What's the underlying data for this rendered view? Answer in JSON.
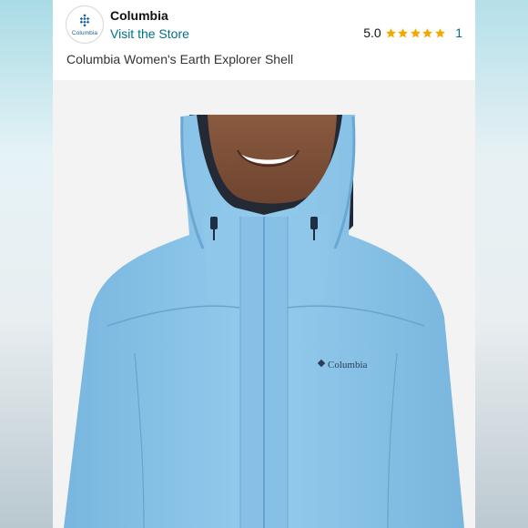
{
  "store": {
    "logo_text": "Columbia",
    "brand_name": "Columbia",
    "link_label": "Visit the Store"
  },
  "rating": {
    "score": "5.0",
    "stars": 5,
    "count": "1",
    "star_color": "#f2a900"
  },
  "product": {
    "title": "Columbia Women's Earth Explorer Shell",
    "image_logo_text": "Columbia",
    "jacket_color": "#8ec6e8"
  },
  "colors": {
    "link": "#007185",
    "logo_blue": "#1a5e9c"
  }
}
